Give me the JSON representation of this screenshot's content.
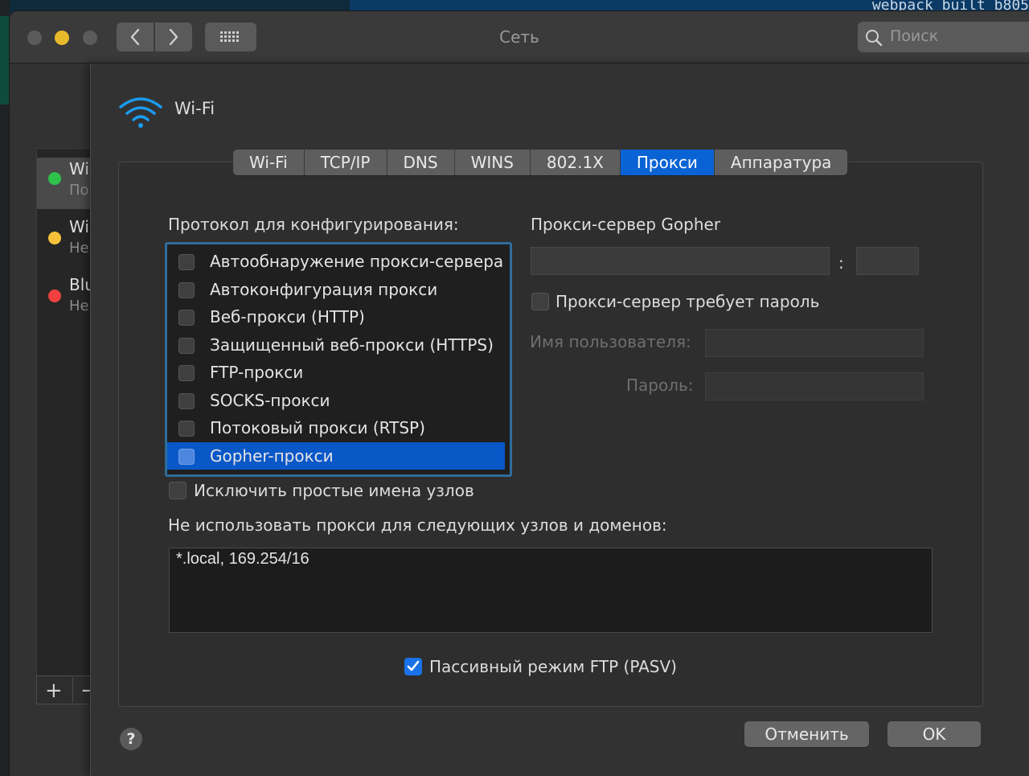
{
  "window": {
    "title": "Сеть",
    "search_placeholder": "Поиск"
  },
  "background": {
    "terminal_text": "webpack built b805"
  },
  "sidebar": {
    "items": [
      {
        "name": "Wi",
        "status": "По",
        "dot_color": "#2fc24b"
      },
      {
        "name": "Wi",
        "status": "Не",
        "dot_color": "#f6c23a"
      },
      {
        "name": "Blu",
        "status": "Не",
        "dot_color": "#f04040"
      }
    ],
    "add_label": "+",
    "remove_label": "−"
  },
  "sheet": {
    "interface_name": "Wi-Fi",
    "tabs": [
      {
        "label": "Wi-Fi",
        "active": false
      },
      {
        "label": "TCP/IP",
        "active": false
      },
      {
        "label": "DNS",
        "active": false
      },
      {
        "label": "WINS",
        "active": false
      },
      {
        "label": "802.1X",
        "active": false
      },
      {
        "label": "Прокси",
        "active": true
      },
      {
        "label": "Аппаратура",
        "active": false
      }
    ],
    "protocol_heading": "Протокол для конфигурирования:",
    "protocols": [
      {
        "label": "Автообнаружение прокси-сервера",
        "checked": false,
        "selected": false
      },
      {
        "label": "Автоконфигурация прокси",
        "checked": false,
        "selected": false
      },
      {
        "label": "Веб-прокси (HTTP)",
        "checked": false,
        "selected": false
      },
      {
        "label": "Защищенный веб-прокси (HTTPS)",
        "checked": false,
        "selected": false
      },
      {
        "label": "FTP-прокси",
        "checked": false,
        "selected": false
      },
      {
        "label": "SOCKS-прокси",
        "checked": false,
        "selected": false
      },
      {
        "label": "Потоковый прокси (RTSP)",
        "checked": false,
        "selected": false
      },
      {
        "label": "Gopher-прокси",
        "checked": false,
        "selected": true
      }
    ],
    "proxy_server_heading": "Прокси-сервер Gopher",
    "server_value": "",
    "port_separator": ":",
    "port_value": "",
    "requires_password_label": "Прокси-сервер требует пароль",
    "requires_password_checked": false,
    "username_label": "Имя пользователя:",
    "username_value": "",
    "password_label": "Пароль:",
    "password_value": "",
    "exclude_simple_label": "Исключить простые имена узлов",
    "exclude_simple_checked": false,
    "bypass_heading": "Не использовать прокси для следующих узлов и доменов:",
    "bypass_value": "*.local, 169.254/16",
    "passive_ftp_label": "Пассивный режим FTP (PASV)",
    "passive_ftp_checked": true,
    "help_label": "?",
    "cancel_label": "Отменить",
    "ok_label": "OK"
  }
}
